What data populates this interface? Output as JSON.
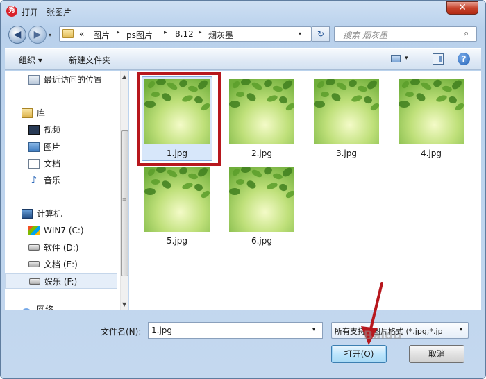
{
  "window": {
    "title": "打开一张图片",
    "close_glyph": "✕",
    "app_icon_glyph": "秀"
  },
  "nav": {
    "back_glyph": "◀",
    "forward_glyph": "▶",
    "recent_glyph": "▾",
    "address": {
      "overflow": "«",
      "crumbs": [
        "图片",
        "ps图片",
        "8.12",
        "烟灰墨"
      ],
      "separator": "▸",
      "drop_glyph": "▾"
    },
    "refresh_glyph": "↻",
    "search": {
      "placeholder": "搜索 烟灰墨",
      "icon": "search-icon",
      "glyph": "⌕"
    }
  },
  "toolbar": {
    "organize_label": "组织 ▾",
    "new_folder_label": "新建文件夹",
    "view_dd": "▾",
    "help_glyph": "?"
  },
  "sidebar": {
    "items": [
      {
        "label": "最近访问的位置",
        "icon": "recent-places-icon"
      },
      {
        "label": "库",
        "icon": "library-icon"
      },
      {
        "label": "视频",
        "icon": "video-icon"
      },
      {
        "label": "图片",
        "icon": "pictures-icon"
      },
      {
        "label": "文档",
        "icon": "documents-icon"
      },
      {
        "label": "音乐",
        "icon": "music-icon",
        "glyph": "♪"
      },
      {
        "label": "计算机",
        "icon": "computer-icon"
      },
      {
        "label": "WIN7 (C:)",
        "icon": "windows-drive-icon"
      },
      {
        "label": "软件 (D:)",
        "icon": "drive-icon"
      },
      {
        "label": "文档 (E:)",
        "icon": "drive-icon"
      },
      {
        "label": "娱乐 (F:)",
        "icon": "drive-icon",
        "selected": true
      },
      {
        "label": "网络",
        "icon": "network-icon"
      }
    ],
    "scroll_up": "▲",
    "scroll_down": "▼",
    "grip": "≡"
  },
  "files": [
    {
      "name": "1.jpg",
      "selected": true
    },
    {
      "name": "2.jpg"
    },
    {
      "name": "3.jpg"
    },
    {
      "name": "4.jpg"
    },
    {
      "name": "5.jpg"
    },
    {
      "name": "6.jpg"
    }
  ],
  "footer": {
    "filename_label": "文件名(N):",
    "filename_value": "1.jpg",
    "filename_dd": "▾",
    "filter_value": "所有支持的图片格式 (*.jpg;*.jp",
    "filter_dd": "▾",
    "open_label": "打开(O)",
    "cancel_label": "取消"
  },
  "watermark": "Baidu",
  "colors": {
    "highlight_box": "#b7171d",
    "annotation_arrow": "#b7171d",
    "selection": "#d7e7fa"
  }
}
